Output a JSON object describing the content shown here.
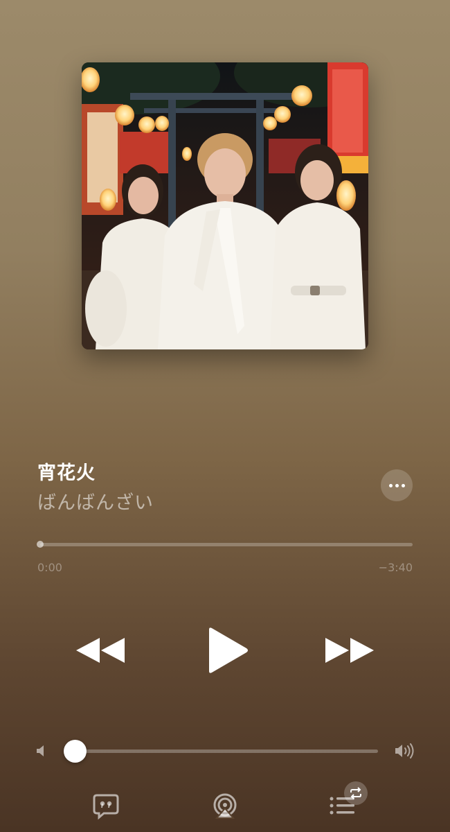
{
  "now_playing": {
    "title": "宵花火",
    "artist": "ばんばんざい",
    "artwork_description_icon": "album-artwork"
  },
  "playback": {
    "elapsed": "0:00",
    "remaining": "−3:40",
    "progress_fraction": 0.0,
    "state": "paused"
  },
  "volume": {
    "level_fraction": 0.03
  },
  "icons": {
    "more": "ellipsis-icon",
    "rewind": "rewind-icon",
    "play": "play-icon",
    "forward": "fast-forward-icon",
    "volume_low": "speaker-low-icon",
    "volume_high": "speaker-high-icon",
    "lyrics": "lyrics-bubble-icon",
    "airplay": "airplay-icon",
    "queue": "queue-list-icon",
    "repeat": "repeat-icon"
  },
  "colors": {
    "background_top": "#9c8a6a",
    "background_bottom": "#4a3424",
    "foreground": "#ffffff"
  }
}
